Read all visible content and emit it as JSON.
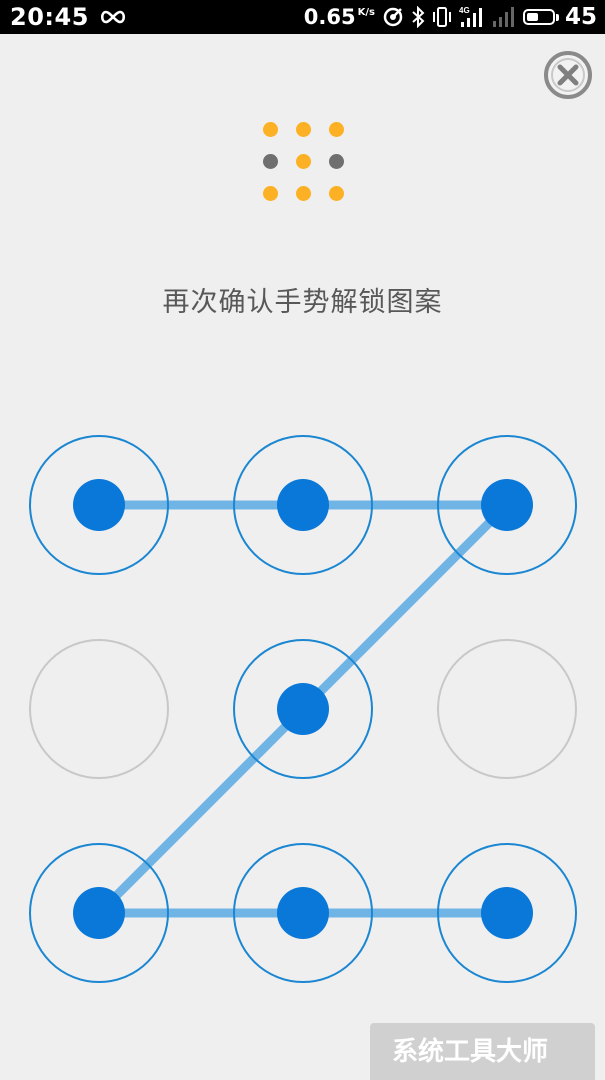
{
  "status_bar": {
    "time": "20:45",
    "net_speed_value": "0.65",
    "net_speed_unit": "K/s",
    "network_type": "4G",
    "battery_level": "45",
    "icons": [
      "infinity-icon",
      "hotspot-icon",
      "bluetooth-icon",
      "vibrate-icon",
      "signal-icon",
      "signal-weak-icon",
      "battery-icon"
    ]
  },
  "close_icon": "close-icon",
  "preview": {
    "active_color": "#fbb123",
    "inactive_color": "#6f6f6f",
    "dots": [
      true,
      true,
      true,
      false,
      true,
      false,
      true,
      true,
      true
    ]
  },
  "instruction": "再次确认手势解锁图案",
  "pattern": {
    "selected": [
      true,
      true,
      true,
      false,
      true,
      false,
      true,
      true,
      true
    ],
    "path": [
      1,
      2,
      3,
      5,
      7,
      8,
      9
    ],
    "node_color": "#0a78d8",
    "ring_color": "#1b86d1",
    "line_color": "#70b4e6",
    "inactive_ring_color": "#c8c8c8"
  },
  "watermark": {
    "text": "系统工具大师"
  }
}
